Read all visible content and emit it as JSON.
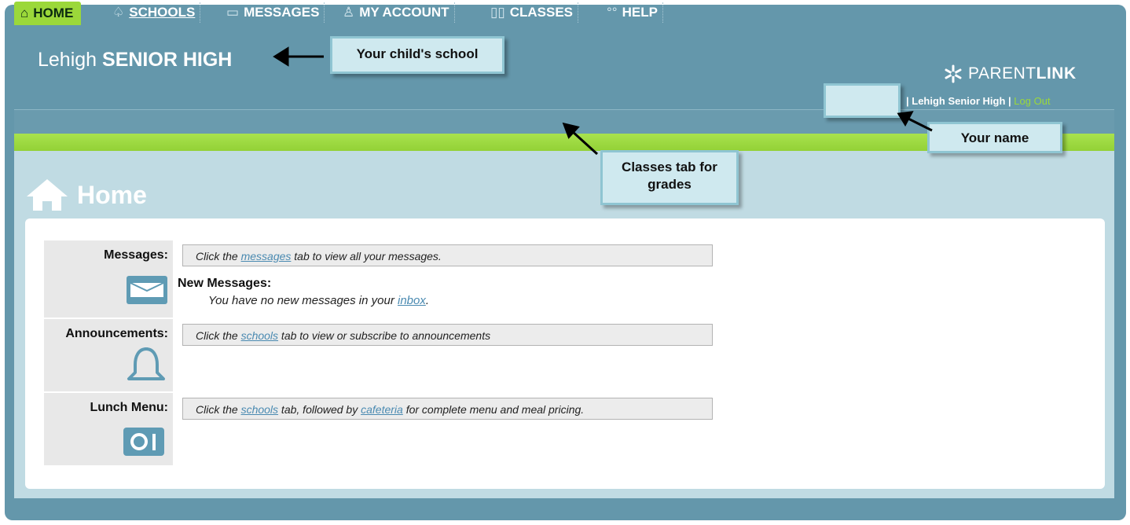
{
  "header": {
    "school_prefix": "Lehigh",
    "school_name": "SENIOR HIGH",
    "logo_prefix": "PARENT",
    "logo_suffix": "LINK",
    "user_school": "| Lehigh Senior High |",
    "logout_label": "Log Out"
  },
  "tabs": [
    {
      "label": "HOME",
      "icon": "home-icon"
    },
    {
      "label": "SCHOOLS",
      "icon": "bell-icon"
    },
    {
      "label": "MESSAGES",
      "icon": "envelope-icon"
    },
    {
      "label": "MY ACCOUNT",
      "icon": "person-icon"
    },
    {
      "label": "CLASSES",
      "icon": "book-icon"
    },
    {
      "label": "HELP",
      "icon": "help-icon"
    }
  ],
  "page": {
    "title": "Home"
  },
  "sections": {
    "messages": {
      "label": "Messages:",
      "text_before": "Click the ",
      "link": "messages",
      "text_after": " tab to view all your messages.",
      "new_title": "New Messages:",
      "new_text_before": "You have no new messages in your ",
      "new_link": "inbox",
      "new_text_after": "."
    },
    "announcements": {
      "label": "Announcements:",
      "text_before": "Click the ",
      "link": "schools",
      "text_after": " tab to view or subscribe to announcements"
    },
    "lunch": {
      "label": "Lunch Menu:",
      "text_before": "Click the ",
      "link1": "schools",
      "text_middle": " tab, followed by ",
      "link2": "cafeteria",
      "text_after": " for complete menu and meal pricing."
    }
  },
  "callouts": {
    "school": "Your child's school",
    "classes_line1": "Classes tab for",
    "classes_line2": "grades",
    "name": "Your name"
  },
  "colors": {
    "frame": "#6497ab",
    "accent_green": "#9bd83a",
    "link": "#4a8ab1",
    "panel": "#c0dbe3"
  }
}
